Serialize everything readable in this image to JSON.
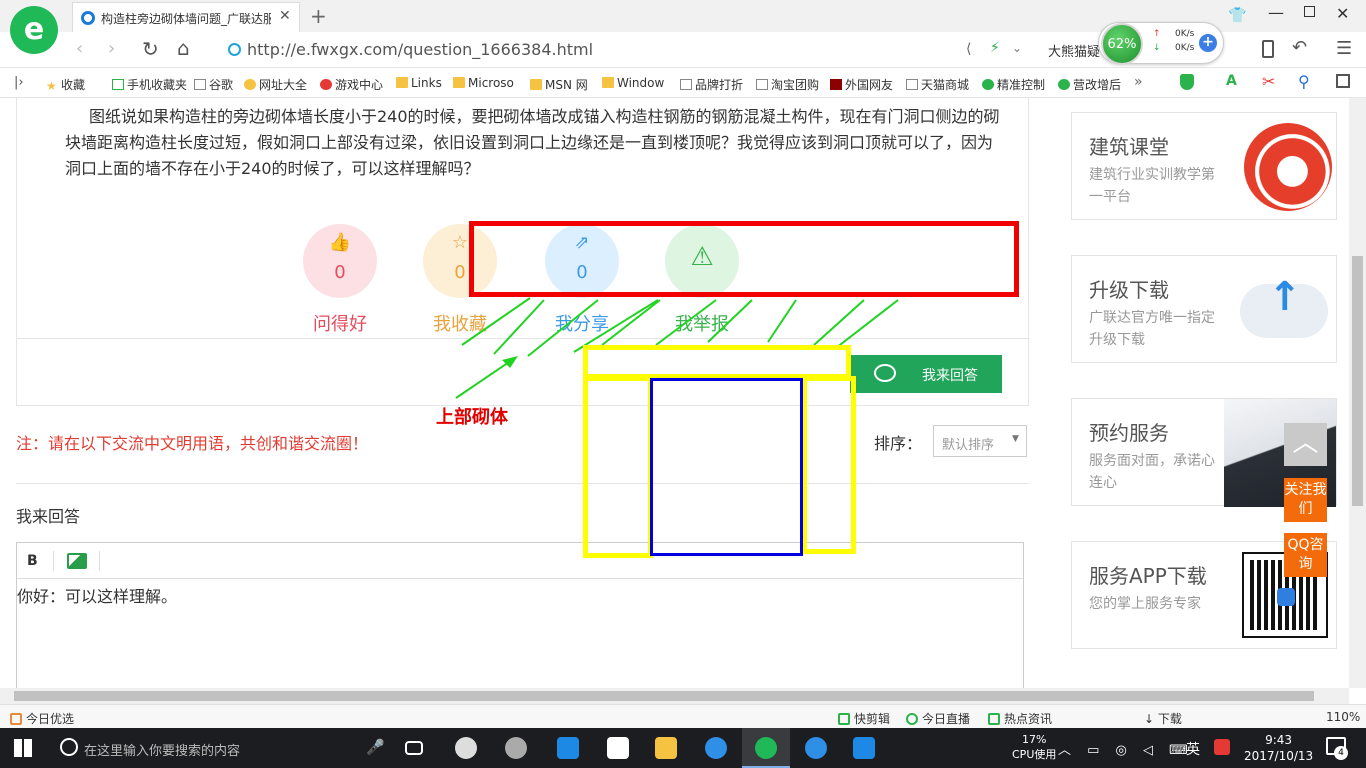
{
  "browser": {
    "tab_title": "构造柱旁边砌体墙问题_广联达服",
    "url": "http://e.fwxgx.com/question_1666384.html",
    "addr_search": "大熊猫疑",
    "speed": {
      "percent": "62%",
      "up": "0K/s",
      "down": "0K/s"
    }
  },
  "bookmarks": [
    "收藏",
    "手机收藏夹",
    "谷歌",
    "网址大全",
    "游戏中心",
    "Links",
    "Microso",
    "MSN 网",
    "Window",
    "品牌打折",
    "淘宝团购",
    "外国网友",
    "天猫商城",
    "精准控制",
    "营改增后"
  ],
  "question": {
    "text": "图纸说如果构造柱的旁边砌体墙长度小于240的时候，要把砌体墙改成锚入构造柱钢筋的钢筋混凝土构件，现在有门洞口侧边的砌块墙距离构造柱长度过短，假如洞口上部没有过梁，依旧设置到洞口上边缘还是一直到楼顶呢？我觉得应该到洞口顶就可以了，因为洞口上面的墙不存在小于240的时候了，可以这样理解吗？"
  },
  "actions": [
    {
      "label": "问得好",
      "count": "0",
      "icon": "thumbs-up-icon"
    },
    {
      "label": "我收藏",
      "count": "0",
      "icon": "star-icon"
    },
    {
      "label": "我分享",
      "count": "0",
      "icon": "share-icon"
    },
    {
      "label": "我举报",
      "count": "",
      "icon": "warning-icon"
    }
  ],
  "answer_button": "我来回答",
  "notice": "注：请在以下交流中文明用语，共创和谐交流圈！",
  "sort": {
    "label": "排序：",
    "value": "默认排序"
  },
  "reply_label": "我来回答",
  "editor": {
    "bold": "B",
    "content": "你好：可以这样理解。"
  },
  "annotation_label": "上部砌体",
  "sidebar": [
    {
      "title": "建筑课堂",
      "desc": "建筑行业实训教学第一平台"
    },
    {
      "title": "升级下载",
      "desc": "广联达官方唯一指定升级下载"
    },
    {
      "title": "预约服务",
      "desc": "服务面对面，承诺心连心"
    },
    {
      "title": "服务APP下载",
      "desc": "您的掌上服务专家"
    }
  ],
  "float_buttons": {
    "follow": "关注我们",
    "qq": "QQ咨询"
  },
  "statusbar": {
    "left": "今日优选",
    "items": [
      "快剪辑",
      "今日直播",
      "热点资讯",
      "下载"
    ],
    "zoom": "110%"
  },
  "taskbar": {
    "search_placeholder": "在这里输入你要搜索的内容",
    "cpu_percent": "17%",
    "cpu_label": "CPU使用",
    "ime": "英",
    "time": "9:43",
    "date": "2017/10/13",
    "notifications": "4"
  },
  "colors": {
    "brand_green": "#21a55a",
    "annotation_red": "#f20000",
    "annotation_yellow": "#ffff00",
    "annotation_blue": "#0000e0"
  }
}
